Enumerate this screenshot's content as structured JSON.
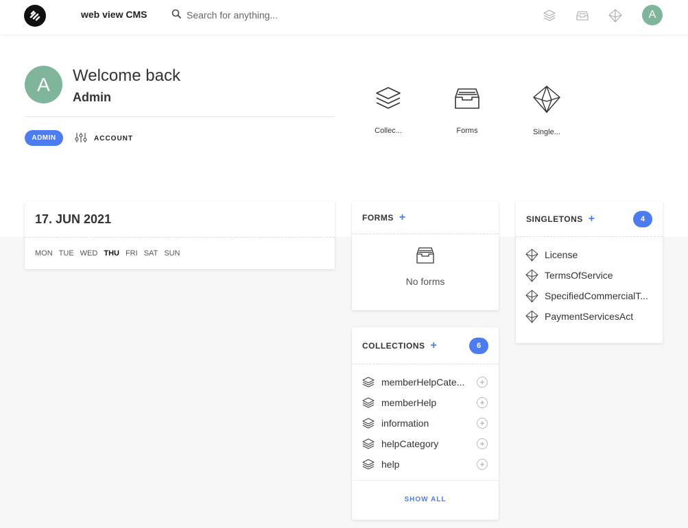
{
  "app": {
    "title": "web view CMS",
    "search_placeholder": "Search for anything...",
    "user_initial": "A"
  },
  "welcome": {
    "greeting": "Welcome back",
    "user_name": "Admin",
    "avatar_initial": "A",
    "role_badge": "ADMIN",
    "account_label": "ACCOUNT"
  },
  "quick_links": [
    {
      "label": "Collec...",
      "icon": "layers-icon"
    },
    {
      "label": "Forms",
      "icon": "inbox-icon"
    },
    {
      "label": "Single...",
      "icon": "diamond-icon"
    }
  ],
  "calendar": {
    "date": "17. JUN 2021",
    "days": [
      "MON",
      "TUE",
      "WED",
      "THU",
      "FRI",
      "SAT",
      "SUN"
    ],
    "today": "THU"
  },
  "forms": {
    "title": "FORMS",
    "plus": "+",
    "empty_text": "No forms"
  },
  "collections": {
    "title": "COLLECTIONS",
    "plus": "+",
    "count": "6",
    "items": [
      {
        "label": "memberHelpCate..."
      },
      {
        "label": "memberHelp"
      },
      {
        "label": "information"
      },
      {
        "label": "helpCategory"
      },
      {
        "label": "help"
      }
    ],
    "show_all": "SHOW ALL"
  },
  "singletons": {
    "title": "SINGLETONS",
    "plus": "+",
    "count": "4",
    "items": [
      {
        "label": "License"
      },
      {
        "label": "TermsOfService"
      },
      {
        "label": "SpecifiedCommercialT..."
      },
      {
        "label": "PaymentServicesAct"
      }
    ]
  },
  "colors": {
    "accent": "#4d7cf0",
    "avatar": "#7fb59a"
  }
}
